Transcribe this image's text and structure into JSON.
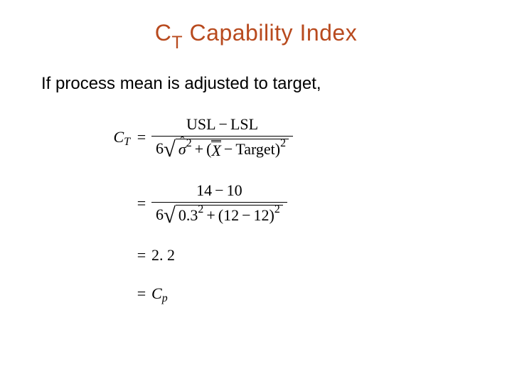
{
  "title": {
    "c": "C",
    "sub": "T",
    "rest": " Capability Index"
  },
  "body": "If process mean is adjusted to target,",
  "eq1": {
    "lhs_c": "C",
    "lhs_sub": "T",
    "eq": "=",
    "num_usl": "USL",
    "num_minus": "−",
    "num_lsl": "LSL",
    "den_six": "6",
    "den_sigma": "σ",
    "den_hat": "ˆ",
    "den_sq1": "2",
    "den_plus": "+",
    "den_lp": "(",
    "den_x": "X",
    "den_minus": "−",
    "den_target": "Target",
    "den_rp": ")",
    "den_sq2": "2"
  },
  "eq2": {
    "eq": "=",
    "num_a": "14",
    "num_minus": "−",
    "num_b": "10",
    "den_six": "6",
    "den_v1": "0.3",
    "den_sq1": "2",
    "den_plus": "+",
    "den_lp": "(",
    "den_v2": "12",
    "den_minus": "−",
    "den_v3": "12",
    "den_rp": ")",
    "den_sq2": "2"
  },
  "eq3": {
    "eq": "=",
    "val": "2. 2"
  },
  "eq4": {
    "eq": "=",
    "c": "C",
    "sub": "p"
  }
}
